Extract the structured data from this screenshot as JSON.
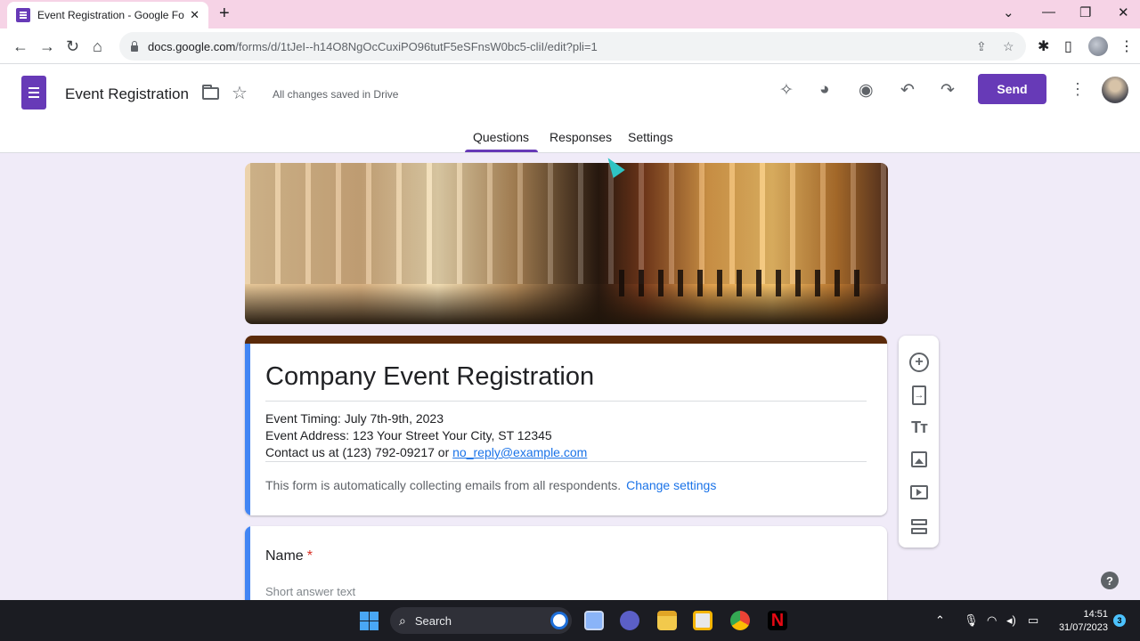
{
  "browser": {
    "tab_title": "Event Registration - Google Forms",
    "tab_close": "✕",
    "new_tab": "+",
    "url_host": "docs.google.com",
    "url_path": "/forms/d/1tJeI--h14O8NgOcCuxiPO96tutF5eSFnsW0bc5-cliI/edit?pli=1"
  },
  "header": {
    "form_name": "Event Registration",
    "save_status": "All changes saved in Drive",
    "send_label": "Send"
  },
  "tabs": [
    {
      "label": "Questions",
      "active": true
    },
    {
      "label": "Responses",
      "active": false
    },
    {
      "label": "Settings",
      "active": false
    }
  ],
  "form": {
    "title": "Company Event Registration",
    "description": {
      "line1": "Event Timing: July 7th-9th, 2023",
      "line2": "Event Address: 123 Your Street Your City, ST 12345",
      "line3_prefix": "Contact us at (123) 792-09217 or ",
      "line3_email": "no_reply@example.com"
    },
    "email_notice": "This form is automatically collecting emails from all respondents.",
    "change_settings": "Change settings",
    "theme_color": "#5b2a0a",
    "accent": "#4285f4"
  },
  "question": {
    "title": "Name",
    "required_mark": "*",
    "hint": "Short answer text"
  },
  "taskbar": {
    "search_label": "Search",
    "time": "14:51",
    "date": "31/07/2023",
    "notifications": "3"
  },
  "colors": {
    "brand": "#673ab7",
    "tab_strip": "#f6d3e6",
    "page_bg": "#f0ebf8"
  }
}
